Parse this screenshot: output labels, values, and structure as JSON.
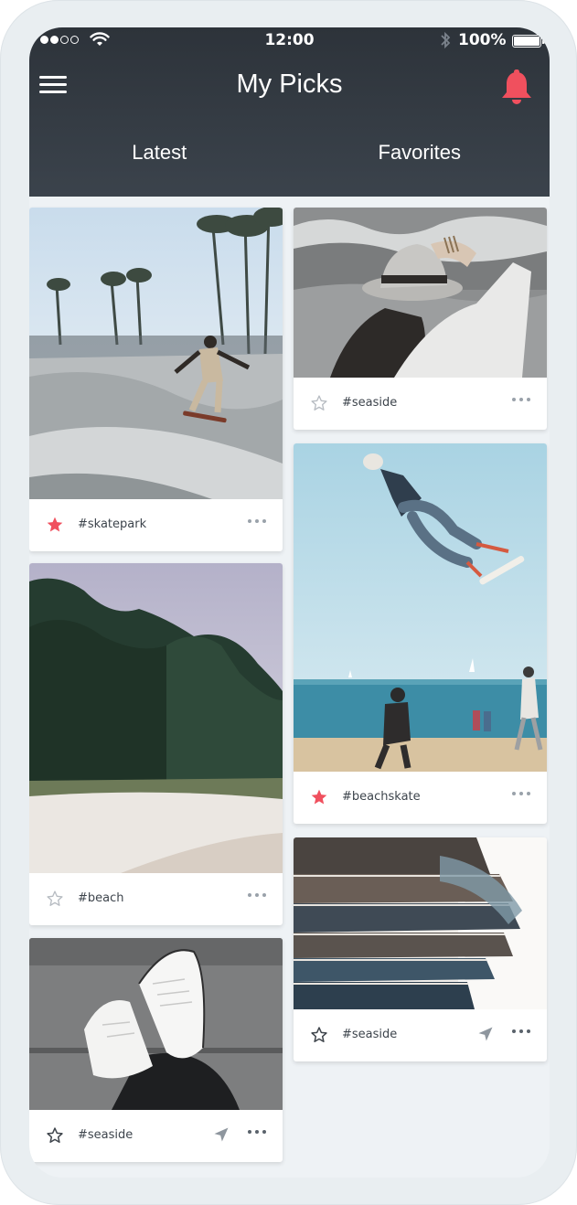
{
  "status_bar": {
    "time": "12:00",
    "battery": "100%"
  },
  "header": {
    "title": "My Picks",
    "menu_icon": "hamburger-menu-icon",
    "bell_icon": "bell-icon",
    "accent": "#f0505e"
  },
  "tabs": [
    {
      "label": "Latest"
    },
    {
      "label": "Favorites"
    }
  ],
  "cards": [
    {
      "tag": "#skatepark",
      "favorited": true
    },
    {
      "tag": "#seaside",
      "favorited": false
    },
    {
      "tag": "#beachskate",
      "favorited": true
    },
    {
      "tag": "#beach",
      "favorited": false
    },
    {
      "tag": "#seaside",
      "favorited": false
    },
    {
      "tag": "#seaside",
      "favorited": false
    }
  ]
}
